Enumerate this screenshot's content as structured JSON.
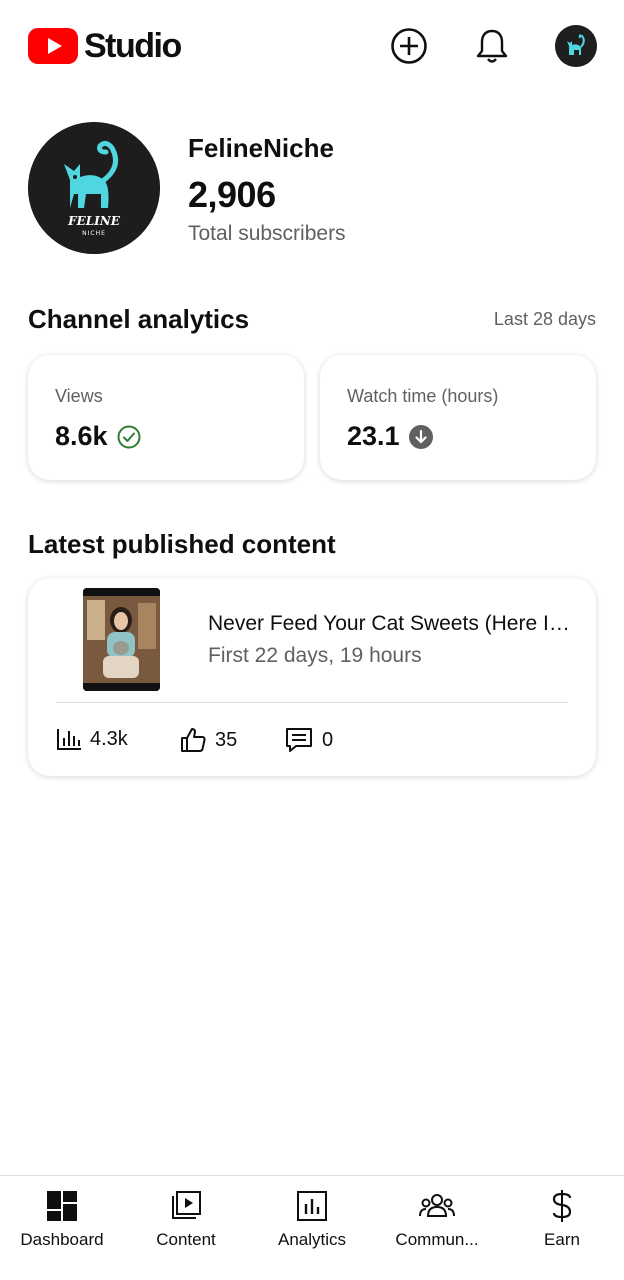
{
  "header": {
    "logo_text": "Studio",
    "icons": [
      "youtube-logo-icon",
      "create-plus-icon",
      "bell-icon",
      "account-avatar"
    ]
  },
  "channel": {
    "name": "FelineNiche",
    "subscribers": "2,906",
    "subscribers_label": "Total subscribers",
    "avatar_text_line1": "FELINE",
    "avatar_text_line2": "NICHE"
  },
  "analytics": {
    "title": "Channel analytics",
    "period": "Last 28 days",
    "metrics": [
      {
        "label": "Views",
        "value": "8.6k",
        "icon": "check-circle-icon",
        "status_color": "#2e7d32"
      },
      {
        "label": "Watch time (hours)",
        "value": "23.1",
        "icon": "arrow-down-circle-icon",
        "status_color": "#606060"
      }
    ]
  },
  "latest": {
    "title": "Latest published content",
    "video_title": "Never Feed Your Cat Sweets (Here Is Why)",
    "video_sub": "First 22 days, 19 hours",
    "stats": {
      "views": "4.3k",
      "likes": "35",
      "comments": "0"
    }
  },
  "nav": {
    "items": [
      {
        "label": "Dashboard",
        "icon": "dashboard-icon"
      },
      {
        "label": "Content",
        "icon": "content-icon"
      },
      {
        "label": "Analytics",
        "icon": "analytics-icon"
      },
      {
        "label": "Commun...",
        "icon": "community-icon"
      },
      {
        "label": "Earn",
        "icon": "dollar-icon"
      }
    ]
  },
  "colors": {
    "brand_red": "#ff0000",
    "cat_teal": "#4fd6e0",
    "text_secondary": "#606060"
  }
}
